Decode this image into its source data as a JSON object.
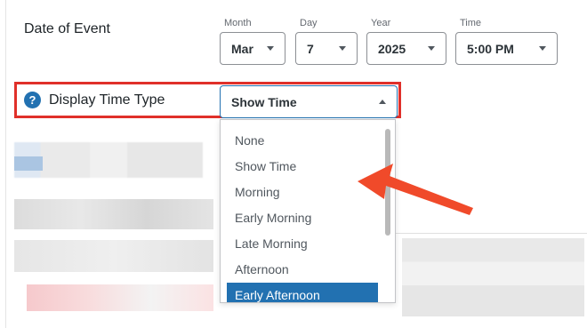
{
  "event_date": {
    "label": "Date of Event",
    "month": {
      "caption": "Month",
      "value": "Mar"
    },
    "day": {
      "caption": "Day",
      "value": "7"
    },
    "year": {
      "caption": "Year",
      "value": "2025"
    },
    "time": {
      "caption": "Time",
      "value": "5:00 PM"
    }
  },
  "display_time_type": {
    "help_icon": "question-circle-icon",
    "help_glyph": "?",
    "label": "Display Time Type",
    "selected_value": "Show Time",
    "options": [
      "None",
      "Show Time",
      "Morning",
      "Early Morning",
      "Late Morning",
      "Afternoon",
      "Early Afternoon"
    ],
    "highlighted_option": "Early Afternoon"
  },
  "annotation": {
    "highlight_color": "#e0302a",
    "arrow_color": "#f04a2a"
  },
  "colors": {
    "accent": "#2271b1"
  }
}
